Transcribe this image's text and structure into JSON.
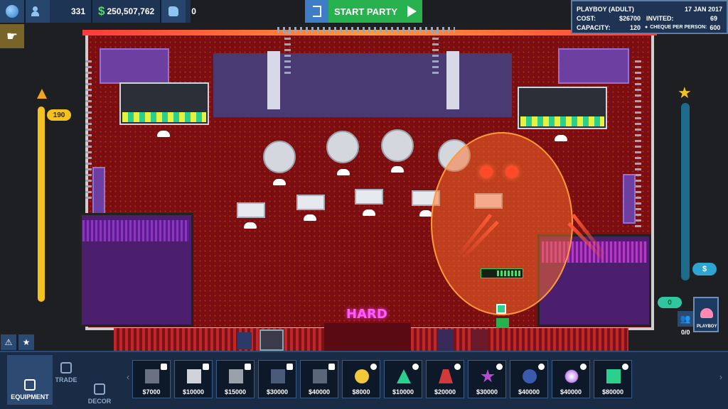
{
  "top_stats": {
    "fans": "331",
    "money": "250,507,762",
    "likes": "0"
  },
  "start_party": {
    "label": "START PARTY"
  },
  "party_info": {
    "name": "PLAYBOY (ADULT)",
    "date": "17 JAN 2017",
    "cost_label": "COST:",
    "cost": "$26700",
    "invited_label": "INVITED:",
    "invited": "69",
    "capacity_label": "CAPACITY:",
    "capacity": "120",
    "cheque_label": "CHEQUE PER PERSON:",
    "cheque": "600"
  },
  "hype_meter": {
    "value": "190",
    "fill_fraction": 1.0
  },
  "right_panel": {
    "dollar_badge": "$",
    "zero_badge": "0",
    "guest_count": "0/0",
    "card_label": "PLAYBOY"
  },
  "club": {
    "sign": "HARD",
    "signal_bars": 4
  },
  "tabs": [
    {
      "label": "EQUIPMENT",
      "icon": "speaker-icon",
      "active": true
    },
    {
      "label": "TRADE",
      "icon": "cash-icon",
      "active": false
    },
    {
      "label": "DECOR",
      "icon": "armchair-icon",
      "active": false
    }
  ],
  "equipment": [
    {
      "price": "$7000",
      "icon": "microphone-stand-icon",
      "category": "speaker"
    },
    {
      "price": "$10000",
      "icon": "speaker-icon",
      "category": "speaker"
    },
    {
      "price": "$15000",
      "icon": "tall-speaker-icon",
      "category": "speaker"
    },
    {
      "price": "$30000",
      "icon": "dj-booth-icon",
      "category": "dj"
    },
    {
      "price": "$40000",
      "icon": "mixer-icon",
      "category": "no-entry"
    },
    {
      "price": "$8000",
      "icon": "sparkle-light-icon",
      "category": "light"
    },
    {
      "price": "$10000",
      "icon": "laser-cone-icon",
      "category": "light"
    },
    {
      "price": "$20000",
      "icon": "beam-light-icon",
      "category": "light"
    },
    {
      "price": "$30000",
      "icon": "star-light-icon",
      "category": "light"
    },
    {
      "price": "$40000",
      "icon": "spider-light-icon",
      "category": "light"
    },
    {
      "price": "$40000",
      "icon": "flare-light-icon",
      "category": "light"
    },
    {
      "price": "$80000",
      "icon": "cube-light-icon",
      "category": "light"
    }
  ],
  "colors": {
    "start_party": "#27b14f",
    "hype": "#f3c21c",
    "panel": "#1a2b45"
  }
}
